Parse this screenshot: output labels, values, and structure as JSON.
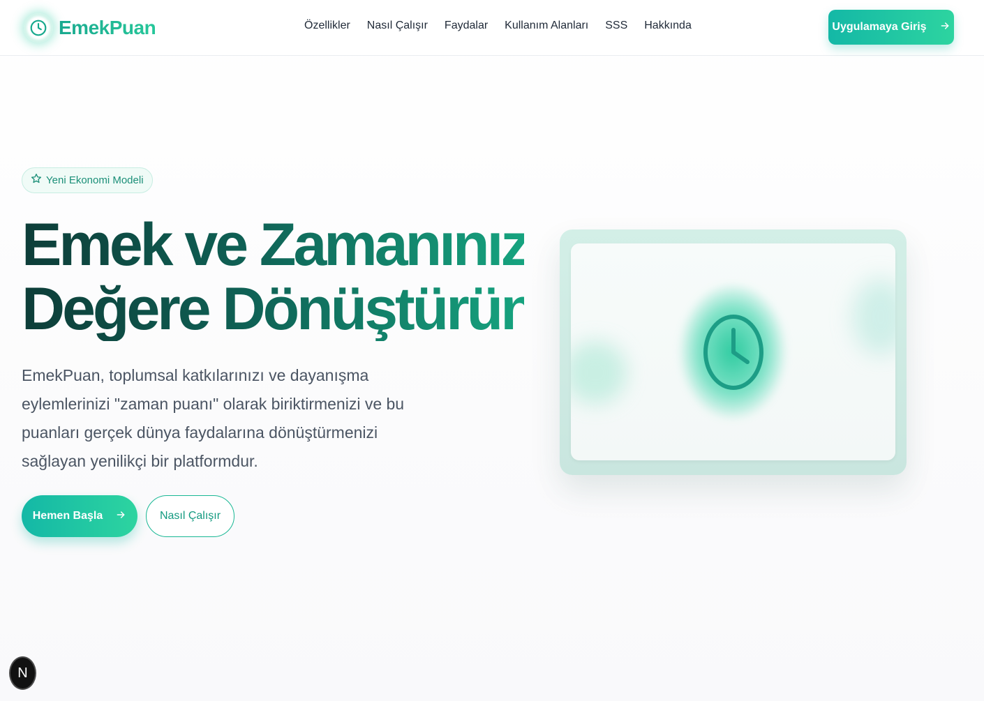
{
  "brand": {
    "name": "EmekPuan",
    "logo_icon": "clock-icon",
    "accent": "#14b8a6",
    "accent_end": "#2dd4a0"
  },
  "nav": {
    "items": [
      {
        "label": "Özellikler"
      },
      {
        "label": "Nasıl Çalışır"
      },
      {
        "label": "Faydalar"
      },
      {
        "label": "Kullanım Alanları"
      },
      {
        "label": "SSS"
      },
      {
        "label": "Hakkında"
      }
    ]
  },
  "header": {
    "cta_label": "Uygulamaya Giriş",
    "cta_icon": "arrow-right-icon"
  },
  "hero": {
    "badge_label": "Yeni Ekonomi Modeli",
    "badge_icon": "star-icon",
    "title_line1": "Emek ve Zamanınızı",
    "title_line2": "Değere Dönüştürün",
    "description": "EmekPuan, toplumsal katkılarınızı ve dayanışma eylemlerinizi \"zaman puanı\" olarak biriktirmenizi ve bu puanları gerçek dünya faydalarına dönüştürmenizi sağlayan yenilikçi bir platformdur.",
    "primary_button": "Hemen Başla",
    "secondary_button": "Nasıl Çalışır",
    "illustration_icon": "clock-icon"
  },
  "floating_badge": {
    "letter": "N"
  }
}
